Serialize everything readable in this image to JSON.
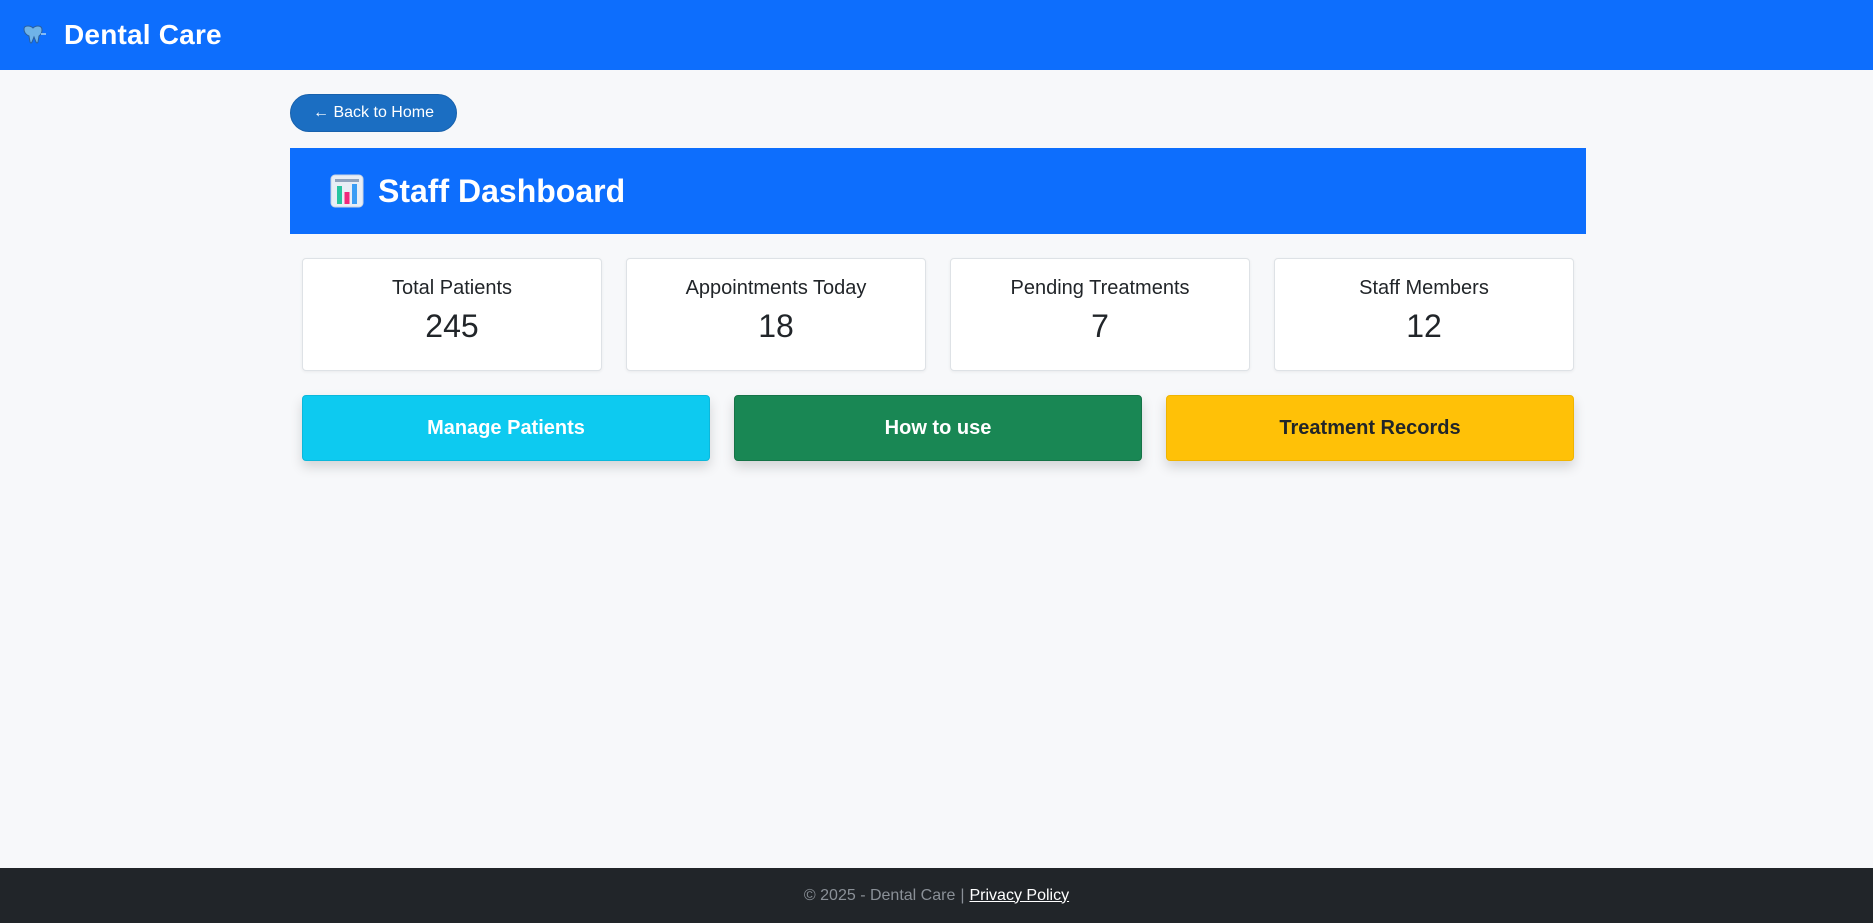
{
  "navbar": {
    "icon": "tooth-icon",
    "title": "Dental Care"
  },
  "back_button": {
    "label": "← Back to Home"
  },
  "dashboard": {
    "icon": "bar-chart-icon",
    "title": "Staff Dashboard"
  },
  "stats": [
    {
      "label": "Total Patients",
      "value": "245"
    },
    {
      "label": "Appointments Today",
      "value": "18"
    },
    {
      "label": "Pending Treatments",
      "value": "7"
    },
    {
      "label": "Staff Members",
      "value": "12"
    }
  ],
  "actions": [
    {
      "label": "Manage Patients",
      "color": "#0dcaf0"
    },
    {
      "label": "How to use",
      "color": "#198754"
    },
    {
      "label": "Treatment Records",
      "color": "#ffc107"
    }
  ],
  "footer": {
    "copyright": "© 2025 - Dental Care",
    "separator": "|",
    "privacy_label": "Privacy Policy"
  },
  "colors": {
    "primary": "#0d6efd",
    "back_button": "#1b6ec2",
    "footer": "#212529",
    "page_background": "#f7f8fa"
  }
}
